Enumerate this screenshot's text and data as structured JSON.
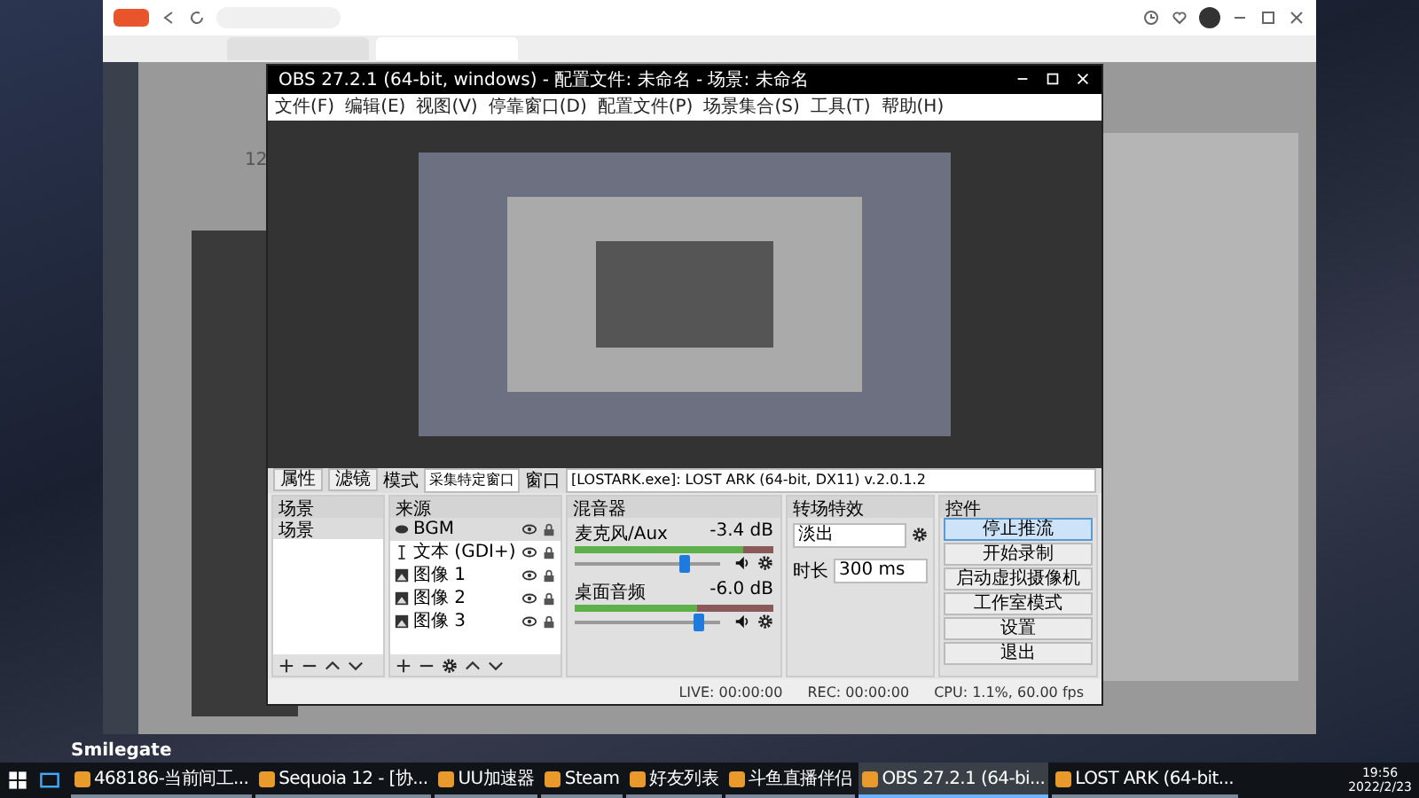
{
  "desktop": {
    "brand": "Smilegate"
  },
  "browser": {
    "tabs": [
      {
        "selected": false
      },
      {
        "selected": true
      }
    ],
    "count": "12"
  },
  "obs": {
    "title": "OBS 27.2.1 (64-bit, windows) - 配置文件: 未命名 - 场景: 未命名",
    "menu": [
      "文件(F)",
      "编辑(E)",
      "视图(V)",
      "停靠窗口(D)",
      "配置文件(P)",
      "场景集合(S)",
      "工具(T)",
      "帮助(H)"
    ],
    "toolbar": {
      "properties": "属性",
      "filters": "滤镜",
      "mode_label": "模式",
      "mode": "采集特定窗口",
      "window_label": "窗口",
      "window": "[LOSTARK.exe]: LOST ARK (64-bit, DX11) v.2.0.1.2"
    },
    "scenes": {
      "title": "场景",
      "items": [
        {
          "label": "场景",
          "selected": true
        }
      ]
    },
    "sources": {
      "title": "来源",
      "items": [
        {
          "label": "BGM",
          "kind": "media",
          "selected": true
        },
        {
          "label": "文本 (GDI+)",
          "kind": "text",
          "selected": false
        },
        {
          "label": "图像 1",
          "kind": "image",
          "selected": false
        },
        {
          "label": "图像 2",
          "kind": "image",
          "selected": false
        },
        {
          "label": "图像 3",
          "kind": "image",
          "selected": false
        }
      ]
    },
    "mixer": {
      "title": "混音器",
      "channels": [
        {
          "name": "麦克风/Aux",
          "reading": "-3.4 dB",
          "meter": {
            "level": 0.85
          },
          "fader": {
            "level": 0.75
          }
        },
        {
          "name": "桌面音频",
          "reading": "-6.0 dB",
          "meter": {
            "level": 0.62
          },
          "fader": {
            "level": 0.85
          }
        }
      ]
    },
    "transitions": {
      "title": "转场特效",
      "type": "淡出",
      "duration_label": "时长",
      "duration": "300 ms"
    },
    "controls": {
      "title": "控件",
      "buttons": [
        {
          "label": "停止推流",
          "active": true
        },
        {
          "label": "开始录制",
          "active": false
        },
        {
          "label": "启动虚拟摄像机",
          "active": false
        },
        {
          "label": "工作室模式",
          "active": false
        },
        {
          "label": "设置",
          "active": false
        },
        {
          "label": "退出",
          "active": false
        }
      ]
    },
    "status": {
      "live": "LIVE: 00:00:00",
      "rec": "REC: 00:00:00",
      "cpu": "CPU: 1.1%, 60.00 fps"
    }
  },
  "taskbar": {
    "apps": [
      {
        "label": "468186-当前间工...",
        "active": false
      },
      {
        "label": "Sequoia 12 - [协...",
        "active": false
      },
      {
        "label": "UU加速器",
        "active": false
      },
      {
        "label": "Steam",
        "active": false
      },
      {
        "label": "好友列表",
        "active": false
      },
      {
        "label": "斗鱼直播伴侣",
        "active": false
      },
      {
        "label": "OBS 27.2.1 (64-bi...",
        "active": true
      },
      {
        "label": "LOST ARK (64-bit...",
        "active": false
      }
    ],
    "time": "19:56",
    "date": "2022/2/23"
  }
}
